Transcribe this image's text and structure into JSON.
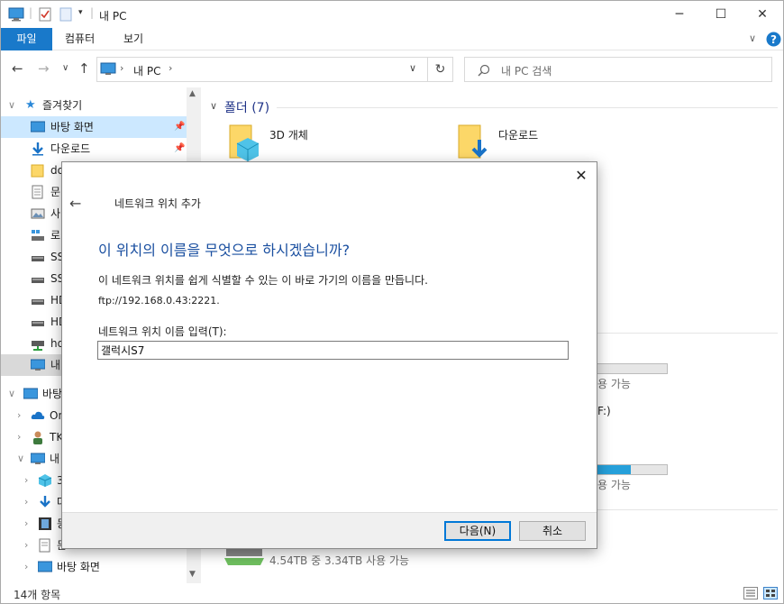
{
  "window": {
    "title": "내 PC"
  },
  "ribbon": {
    "tabs": [
      "파일",
      "컴퓨터",
      "보기"
    ]
  },
  "address": {
    "crumb": "내 PC",
    "search_placeholder": "내 PC 검색"
  },
  "nav": {
    "quick_access": "즐겨찾기",
    "items": [
      {
        "label": "바탕 화면"
      },
      {
        "label": "다운로드"
      },
      {
        "label": "do"
      },
      {
        "label": "문"
      },
      {
        "label": "사"
      },
      {
        "label": "로"
      },
      {
        "label": "SS"
      },
      {
        "label": "SS"
      },
      {
        "label": "HD"
      },
      {
        "label": "HD"
      },
      {
        "label": "hd"
      },
      {
        "label": "내"
      },
      {
        "label": "바탕"
      },
      {
        "label": "On"
      },
      {
        "label": "TK"
      },
      {
        "label": "내"
      },
      {
        "label": "3"
      },
      {
        "label": "다"
      },
      {
        "label": "동"
      },
      {
        "label": "문"
      },
      {
        "label": "바탕 화면"
      }
    ]
  },
  "content": {
    "folders_header": "폴더 (7)",
    "folders": [
      {
        "label": "3D 개체"
      },
      {
        "label": "다운로드"
      }
    ],
    "drive_partial_1": "용 가능",
    "drive_partial_2": "F:)",
    "drive_partial_3": "용 가능",
    "drive_bottom_size": "4.54TB 중 3.34TB 사용 가능",
    "drive_bars": [
      0.0,
      0.53
    ]
  },
  "status": {
    "count": "14개 항목"
  },
  "dialog": {
    "title": "네트워크 위치 추가",
    "heading": "이 위치의 이름을 무엇으로 하시겠습니까?",
    "description": "이 네트워크 위치를 쉽게 식별할 수 있는 이 바로 가기의 이름을 만듭니다.",
    "address": "ftp://192.168.0.43:2221.",
    "input_label": "네트워크 위치 이름 입력(T):",
    "input_value": "갤럭시S7",
    "next_button": "다음(N)",
    "cancel_button": "취소"
  },
  "colors": {
    "accent": "#1979ca",
    "selection": "#cce8ff",
    "heading": "#1a4fa0",
    "progress": "#26a0da"
  }
}
